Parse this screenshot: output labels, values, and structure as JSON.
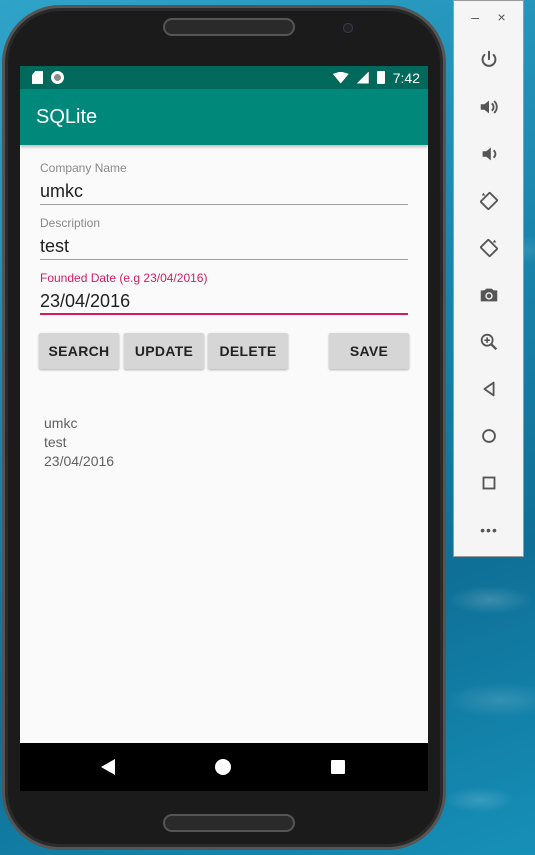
{
  "status_bar": {
    "time": "7:42"
  },
  "app_bar": {
    "title": "SQLite"
  },
  "form": {
    "company_name": {
      "label": "Company Name",
      "value": "umkc"
    },
    "description": {
      "label": "Description",
      "value": "test"
    },
    "founded_date": {
      "label": "Founded Date (e.g 23/04/2016)",
      "value": "23/04/2016"
    }
  },
  "buttons": {
    "search": "SEARCH",
    "update": "UPDATE",
    "delete": "DELETE",
    "save": "SAVE"
  },
  "output": {
    "line1": "umkc",
    "line2": "test",
    "line3": "23/04/2016"
  },
  "emulator_toolbar": {
    "minimize": "–",
    "close": "×",
    "more": "•••",
    "icons": [
      "power-icon",
      "volume-up-icon",
      "volume-down-icon",
      "rotate-left-icon",
      "rotate-right-icon",
      "camera-icon",
      "zoom-icon",
      "back-icon",
      "home-icon",
      "overview-icon",
      "more-icon"
    ]
  },
  "colors": {
    "status_bar": "#00695c",
    "app_bar": "#00897b",
    "accent": "#d81b60",
    "button": "#d6d6d6"
  }
}
